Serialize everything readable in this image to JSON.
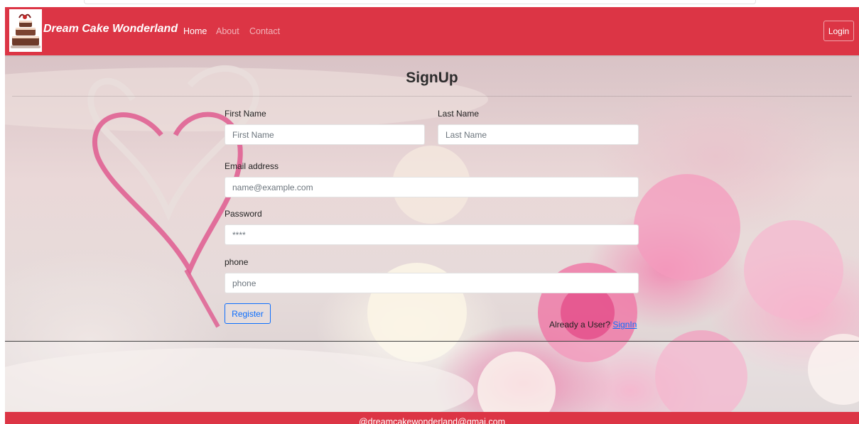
{
  "navbar": {
    "brand": "Dream Cake Wonderland",
    "links": [
      {
        "label": "Home",
        "active": true
      },
      {
        "label": "About",
        "active": false
      },
      {
        "label": "Contact",
        "active": false
      }
    ],
    "login_label": "Login",
    "bg_color": "#dc3545"
  },
  "form": {
    "title": "SignUp",
    "first_name": {
      "label": "First Name",
      "placeholder": "First Name"
    },
    "last_name": {
      "label": "Last Name",
      "placeholder": "Last Name"
    },
    "email": {
      "label": "Email address",
      "placeholder": "name@example.com"
    },
    "password": {
      "label": "Password",
      "placeholder": "****"
    },
    "phone": {
      "label": "phone",
      "placeholder": "phone"
    },
    "register_label": "Register",
    "already_text": "Already a User?",
    "signin_label": "SignIn"
  },
  "footer": {
    "email": "@dreamcakewonderland@gmai.com"
  },
  "colors": {
    "accent": "#dc3545",
    "link": "#0d6efd"
  }
}
